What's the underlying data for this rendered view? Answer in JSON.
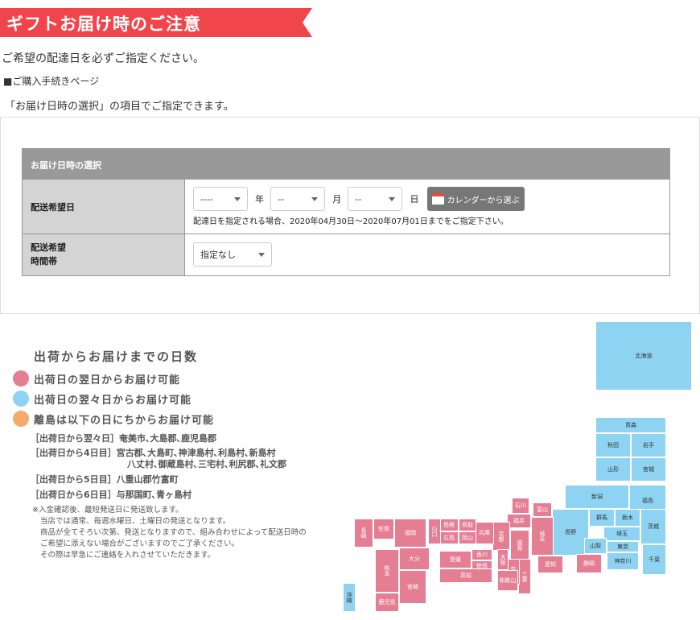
{
  "header": {
    "title": "ギフトお届け時のご注意",
    "banner_color": "#f0454a"
  },
  "intro": "ご希望の配達日を必ずご指定ください。",
  "purchase_page": "■ご購入手続きページ",
  "instruction": "「お届け日時の選択」の項目でご指定できます。",
  "form": {
    "heading": "お届け日時の選択",
    "date_label": "配送希望日",
    "year_value": "----",
    "year_unit": "年",
    "month_value": "--",
    "month_unit": "月",
    "day_value": "--",
    "day_unit": "日",
    "calendar_button": "カレンダーから選ぶ",
    "date_note": "配達日を指定される場合、2020年04月30日～2020年07月01日までをご指定下さい。",
    "time_label_1": "配送希望",
    "time_label_2": "時間帯",
    "time_value": "指定なし"
  },
  "legend": {
    "title": "出荷からお届けまでの日数",
    "items": [
      {
        "text": "出荷日の翌日からお届け可能",
        "color": "#e57e93"
      },
      {
        "text": "出荷日の翌々日からお届け可能",
        "color": "#8ed3f2"
      },
      {
        "text": "離島は以下の日にちからお届け可能",
        "color": "#f5a96b"
      }
    ],
    "islands": [
      {
        "tag": "［出荷日から翌々日］",
        "text": "奄美市､大島郡､鹿児島郡"
      },
      {
        "tag": "［出荷日から4日目］",
        "text": "宮古郡､大島町､神津島村､利島村､新島村",
        "text2": "八丈村､御蔵島村､三宅村､利尻郡､礼文郡"
      },
      {
        "tag": "［出荷日から5日目］",
        "text": "八重山郡竹富町"
      },
      {
        "tag": "［出荷日から6日目］",
        "text": "与那国町､青ヶ島村"
      }
    ],
    "footnotes": [
      "※入金確認後、最短発送日に発送致します。",
      "当店では通常、毎週水曜日、土曜日の発送となります。",
      "商品が全てそろい次第、発送となりますので、組み合わせによって配送日時の",
      "ご希望に添えない場合がございますのでご了承ください。",
      "その際は早急にご連絡を入れさせていただきます。"
    ]
  },
  "map": {
    "prefectures": [
      {
        "name": "北海道",
        "zone": "blue"
      },
      {
        "name": "青森",
        "zone": "blue"
      },
      {
        "name": "秋田",
        "zone": "blue"
      },
      {
        "name": "岩手",
        "zone": "blue"
      },
      {
        "name": "山形",
        "zone": "blue"
      },
      {
        "name": "宮城",
        "zone": "blue"
      },
      {
        "name": "新潟",
        "zone": "blue"
      },
      {
        "name": "福島",
        "zone": "blue"
      },
      {
        "name": "長野",
        "zone": "blue"
      },
      {
        "name": "群馬",
        "zone": "blue"
      },
      {
        "name": "栃木",
        "zone": "blue"
      },
      {
        "name": "茨城",
        "zone": "blue"
      },
      {
        "name": "埼玉",
        "zone": "blue"
      },
      {
        "name": "山梨",
        "zone": "blue"
      },
      {
        "name": "東京",
        "zone": "blue"
      },
      {
        "name": "千葉",
        "zone": "blue"
      },
      {
        "name": "神奈川",
        "zone": "blue"
      },
      {
        "name": "沖縄",
        "zone": "blue"
      },
      {
        "name": "石川",
        "zone": "pink"
      },
      {
        "name": "富山",
        "zone": "pink"
      },
      {
        "name": "福井",
        "zone": "pink"
      },
      {
        "name": "岐阜",
        "zone": "pink"
      },
      {
        "name": "静岡",
        "zone": "pink"
      },
      {
        "name": "愛知",
        "zone": "pink"
      },
      {
        "name": "滋賀",
        "zone": "pink"
      },
      {
        "name": "京都",
        "zone": "pink"
      },
      {
        "name": "三重",
        "zone": "pink"
      },
      {
        "name": "奈良",
        "zone": "pink"
      },
      {
        "name": "大阪",
        "zone": "pink"
      },
      {
        "name": "和歌山",
        "zone": "pink"
      },
      {
        "name": "兵庫",
        "zone": "pink"
      },
      {
        "name": "鳥取",
        "zone": "pink"
      },
      {
        "name": "岡山",
        "zone": "pink"
      },
      {
        "name": "島根",
        "zone": "pink"
      },
      {
        "name": "広島",
        "zone": "pink"
      },
      {
        "name": "山口",
        "zone": "pink"
      },
      {
        "name": "香川",
        "zone": "pink"
      },
      {
        "name": "徳島",
        "zone": "pink"
      },
      {
        "name": "愛媛",
        "zone": "pink"
      },
      {
        "name": "高知",
        "zone": "pink"
      },
      {
        "name": "福岡",
        "zone": "pink"
      },
      {
        "name": "佐賀",
        "zone": "pink"
      },
      {
        "name": "長崎",
        "zone": "pink"
      },
      {
        "name": "大分",
        "zone": "pink"
      },
      {
        "name": "熊本",
        "zone": "pink"
      },
      {
        "name": "宮崎",
        "zone": "pink"
      },
      {
        "name": "鹿児島",
        "zone": "pink"
      }
    ]
  }
}
